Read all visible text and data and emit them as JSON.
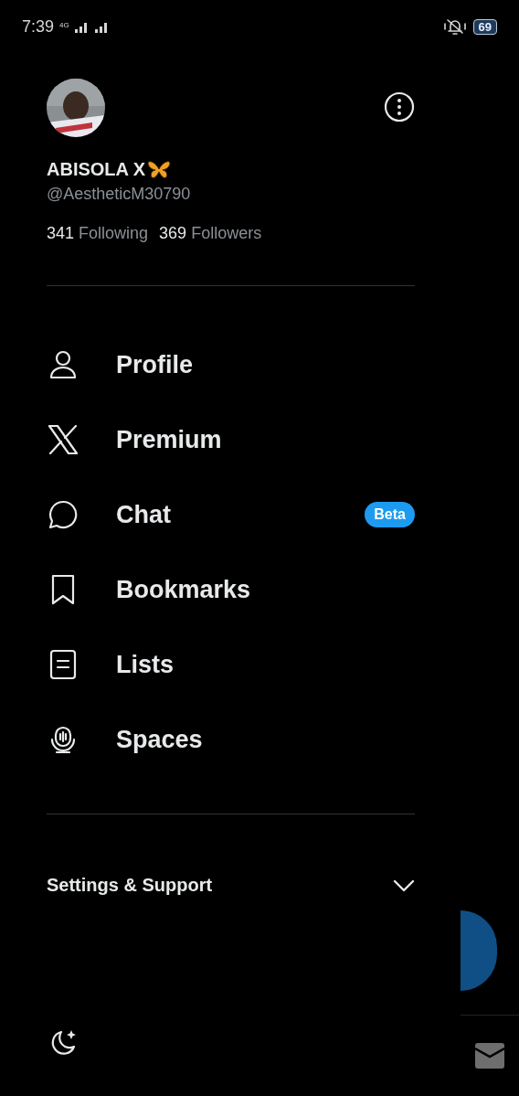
{
  "status_bar": {
    "time": "7:39",
    "network": "4G",
    "battery": "69"
  },
  "account": {
    "name": "ABISOLA X",
    "handle": "@AestheticM30790",
    "following_count": "341",
    "following_label": "Following",
    "followers_count": "369",
    "followers_label": "Followers"
  },
  "menu": [
    {
      "label": "Profile"
    },
    {
      "label": "Premium"
    },
    {
      "label": "Chat",
      "badge": "Beta"
    },
    {
      "label": "Bookmarks"
    },
    {
      "label": "Lists"
    },
    {
      "label": "Spaces"
    }
  ],
  "settings": {
    "label": "Settings & Support",
    "expanded": false
  }
}
